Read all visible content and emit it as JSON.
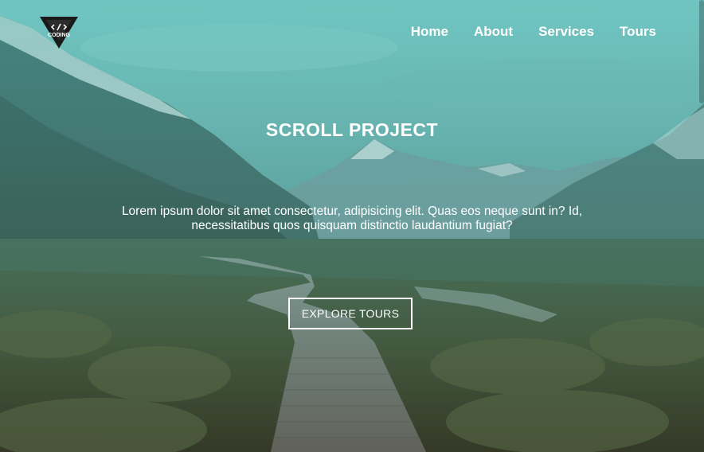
{
  "header": {
    "logo": {
      "name": "coding-logo",
      "text": "CODING"
    },
    "nav": [
      {
        "label": "Home"
      },
      {
        "label": "About"
      },
      {
        "label": "Services"
      },
      {
        "label": "Tours"
      }
    ]
  },
  "hero": {
    "title": "SCROLL PROJECT",
    "description": "Lorem ipsum dolor sit amet consectetur, adipisicing elit. Quas eos neque sunt in? Id, necessitatibus quos quisquam distinctio laudantium fugiat?",
    "button_label": "EXPLORE TOURS"
  },
  "colors": {
    "overlay_tint": "#3eaba9",
    "text": "#ffffff"
  }
}
